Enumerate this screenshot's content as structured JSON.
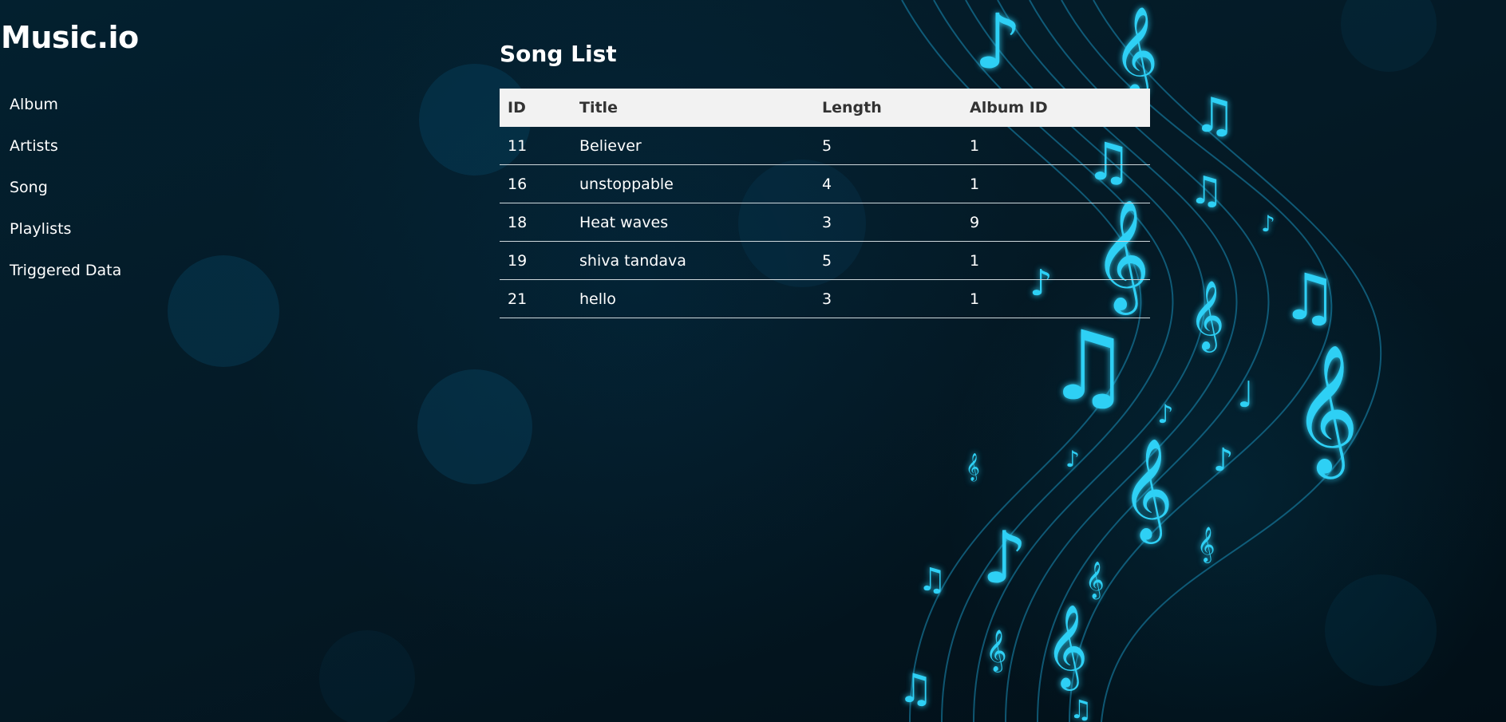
{
  "app": {
    "brand": "Music.io"
  },
  "sidebar": {
    "items": [
      {
        "label": "Album"
      },
      {
        "label": "Artists"
      },
      {
        "label": "Song"
      },
      {
        "label": "Playlists"
      },
      {
        "label": "Triggered Data"
      }
    ]
  },
  "main": {
    "title": "Song List",
    "table": {
      "columns": [
        "ID",
        "Title",
        "Length",
        "Album ID"
      ],
      "rows": [
        {
          "id": "11",
          "title": "Believer",
          "length": "5",
          "album_id": "1"
        },
        {
          "id": "16",
          "title": "unstoppable",
          "length": "4",
          "album_id": "1"
        },
        {
          "id": "18",
          "title": "Heat waves",
          "length": "3",
          "album_id": "9"
        },
        {
          "id": "19",
          "title": "shiva tandava",
          "length": "5",
          "album_id": "1"
        },
        {
          "id": "21",
          "title": "hello",
          "length": "3",
          "album_id": "1"
        }
      ]
    }
  },
  "background": {
    "image": "music-notes-wave-illustration",
    "accent_color": "#1ec8f0",
    "base_color": "#03202f"
  }
}
